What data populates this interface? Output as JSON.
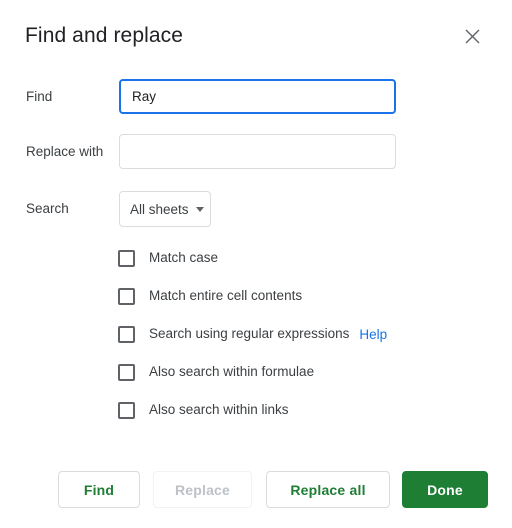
{
  "dialog": {
    "title": "Find and replace",
    "close_icon": "close-icon"
  },
  "fields": {
    "find": {
      "label": "Find",
      "value": "Ray",
      "placeholder": ""
    },
    "replace": {
      "label": "Replace with",
      "value": "",
      "placeholder": ""
    },
    "search": {
      "label": "Search",
      "selected": "All sheets",
      "options": [
        "All sheets"
      ],
      "arrow_icon": "chevron-down-icon"
    }
  },
  "options": [
    {
      "label": "Match case",
      "checked": false
    },
    {
      "label": "Match entire cell contents",
      "checked": false
    },
    {
      "label": "Search using regular expressions",
      "checked": false,
      "help_label": "Help"
    },
    {
      "label": "Also search within formulae",
      "checked": false
    },
    {
      "label": "Also search within links",
      "checked": false
    }
  ],
  "buttons": {
    "find": "Find",
    "replace": "Replace",
    "replace_all": "Replace all",
    "done": "Done"
  },
  "colors": {
    "focus_blue": "#1a73e8",
    "link_blue": "#1a73e8",
    "primary_green": "#1e7e34",
    "border_gray": "#dadce0",
    "disabled_gray": "#bdc1c6",
    "text_primary": "#202124",
    "text_secondary": "#3c4043"
  }
}
